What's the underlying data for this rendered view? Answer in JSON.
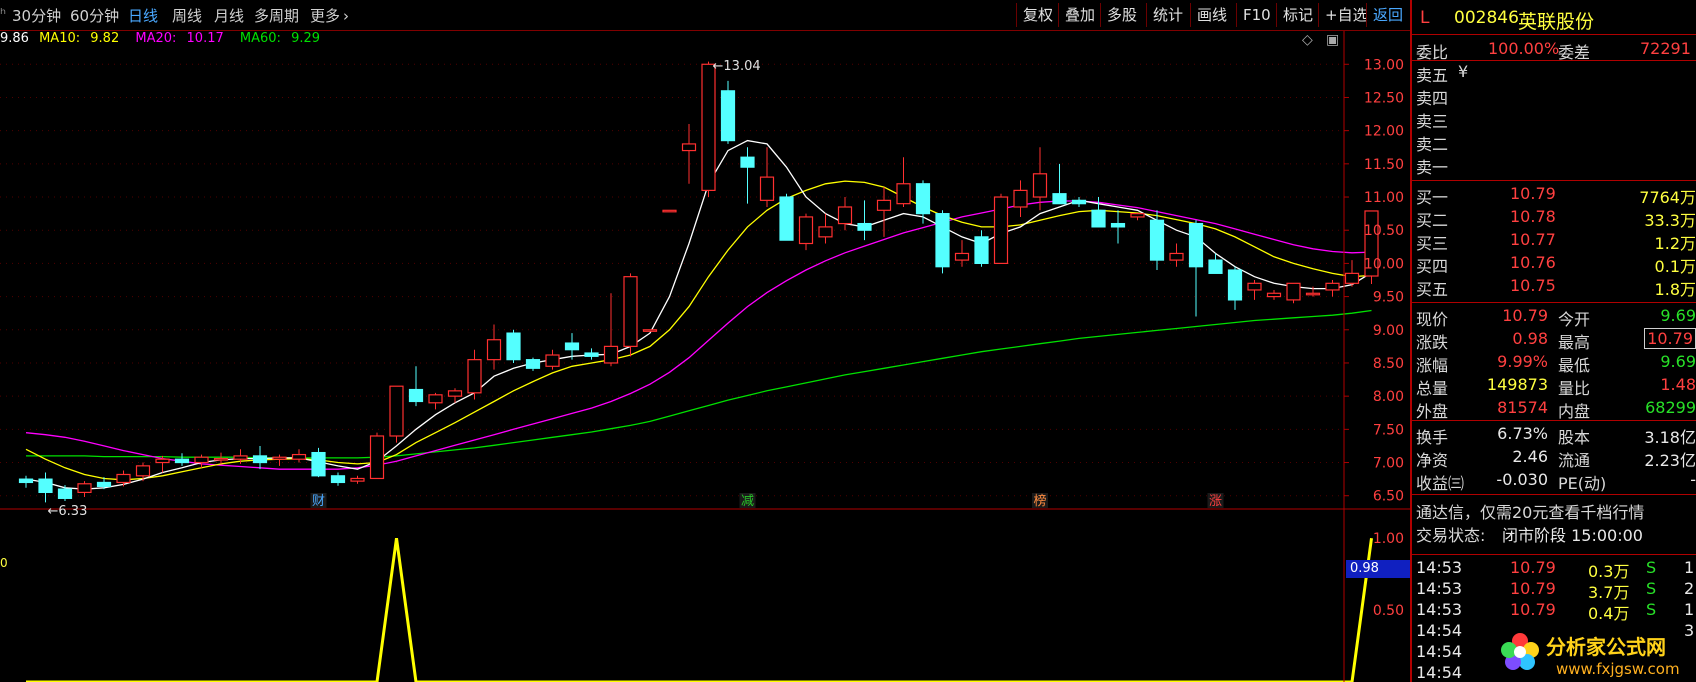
{
  "toolbar": {
    "edge_glyph": "ʰ",
    "periods": [
      "30分钟",
      "60分钟",
      "日线",
      "周线",
      "月线",
      "多周期",
      "更多"
    ],
    "active_period": "日线",
    "more_chevron": "›",
    "buttons": [
      "复权",
      "叠加",
      "多股",
      "统计",
      "画线",
      "F10",
      "标记",
      "+自选",
      "返回"
    ]
  },
  "ma": {
    "ma5": "9.86",
    "ma10_label": "MA10:",
    "ma10": "9.82",
    "ma20_label": "MA20:",
    "ma20": "10.17",
    "ma60_label": "MA60:",
    "ma60": "9.29",
    "colors": {
      "ma5": "#ffffff",
      "ma10": "#ffff00",
      "ma20": "#ff00ff",
      "ma60": "#00e000"
    }
  },
  "chart_icons": {
    "diamond": "◇",
    "window": "▣"
  },
  "annotations": {
    "high": "13.04",
    "low": "6.33",
    "arrow_high": "←",
    "arrow_low": "←"
  },
  "event_markers": [
    {
      "label": "财",
      "color": "#4aa8ff"
    },
    {
      "label": "减",
      "color": "#28c828"
    },
    {
      "label": "榜",
      "color": "#ff8c40"
    },
    {
      "label": "涨",
      "color": "#ff4040"
    }
  ],
  "indicator": {
    "value_badge": "0.98",
    "left_tag": "0",
    "ticks": [
      "1.00",
      "0.50"
    ]
  },
  "chart_data": {
    "type": "candlestick",
    "ylim": [
      6.3,
      13.2
    ],
    "y_ticks": [
      "13.00",
      "12.50",
      "12.00",
      "11.50",
      "11.00",
      "10.50",
      "10.00",
      "9.50",
      "9.00",
      "8.50",
      "8.00",
      "7.50",
      "7.00",
      "6.50"
    ],
    "candles": [
      [
        6.75,
        6.8,
        6.62,
        6.7
      ],
      [
        6.75,
        6.85,
        6.4,
        6.55
      ],
      [
        6.6,
        6.66,
        6.42,
        6.46
      ],
      [
        6.55,
        6.72,
        6.48,
        6.68
      ],
      [
        6.7,
        6.78,
        6.6,
        6.64
      ],
      [
        6.7,
        6.88,
        6.64,
        6.82
      ],
      [
        6.8,
        7.0,
        6.72,
        6.95
      ],
      [
        7.0,
        7.1,
        6.85,
        7.05
      ],
      [
        7.05,
        7.14,
        6.95,
        7.0
      ],
      [
        7.0,
        7.12,
        6.92,
        7.08
      ],
      [
        7.05,
        7.15,
        6.98,
        7.06
      ],
      [
        7.05,
        7.2,
        6.98,
        7.1
      ],
      [
        7.1,
        7.25,
        6.9,
        7.0
      ],
      [
        7.05,
        7.12,
        6.95,
        7.08
      ],
      [
        7.05,
        7.2,
        7.0,
        7.12
      ],
      [
        7.15,
        7.22,
        6.78,
        6.8
      ],
      [
        6.8,
        6.85,
        6.65,
        6.7
      ],
      [
        6.72,
        6.8,
        6.68,
        6.76
      ],
      [
        6.76,
        7.45,
        6.76,
        7.4
      ],
      [
        7.4,
        8.15,
        7.3,
        8.15
      ],
      [
        8.1,
        8.45,
        7.85,
        7.92
      ],
      [
        7.9,
        8.05,
        7.8,
        8.02
      ],
      [
        8.0,
        8.12,
        7.9,
        8.08
      ],
      [
        8.05,
        8.7,
        7.95,
        8.55
      ],
      [
        8.55,
        9.08,
        8.4,
        8.85
      ],
      [
        8.95,
        9.0,
        8.5,
        8.55
      ],
      [
        8.55,
        8.58,
        8.38,
        8.42
      ],
      [
        8.45,
        8.7,
        8.4,
        8.62
      ],
      [
        8.8,
        8.95,
        8.55,
        8.7
      ],
      [
        8.65,
        8.72,
        8.55,
        8.6
      ],
      [
        8.5,
        9.55,
        8.45,
        8.75
      ],
      [
        8.75,
        9.85,
        8.6,
        9.8
      ],
      [
        9.0,
        9.0,
        9.0,
        9.0
      ],
      [
        10.8,
        10.8,
        10.8,
        10.8
      ],
      [
        11.7,
        12.1,
        11.2,
        11.8
      ],
      [
        11.1,
        13.04,
        11.0,
        13.0
      ],
      [
        12.6,
        12.75,
        11.8,
        11.85
      ],
      [
        11.6,
        11.75,
        10.9,
        11.45
      ],
      [
        10.95,
        11.75,
        10.85,
        11.3
      ],
      [
        11.0,
        11.05,
        10.35,
        10.35
      ],
      [
        10.3,
        10.75,
        10.2,
        10.7
      ],
      [
        10.4,
        10.75,
        10.3,
        10.55
      ],
      [
        10.6,
        11.0,
        10.5,
        10.85
      ],
      [
        10.6,
        10.95,
        10.35,
        10.5
      ],
      [
        10.8,
        11.15,
        10.4,
        10.95
      ],
      [
        10.9,
        11.6,
        10.85,
        11.2
      ],
      [
        11.2,
        11.25,
        10.6,
        10.75
      ],
      [
        10.75,
        10.8,
        9.85,
        9.95
      ],
      [
        10.05,
        10.35,
        9.95,
        10.15
      ],
      [
        10.4,
        10.5,
        9.95,
        10.0
      ],
      [
        10.0,
        11.05,
        10.0,
        11.0
      ],
      [
        10.85,
        11.25,
        10.7,
        11.1
      ],
      [
        11.0,
        11.75,
        10.8,
        11.35
      ],
      [
        11.05,
        11.5,
        10.95,
        10.9
      ],
      [
        10.95,
        11.0,
        10.85,
        10.9
      ],
      [
        10.8,
        11.0,
        10.6,
        10.55
      ],
      [
        10.6,
        10.8,
        10.3,
        10.55
      ],
      [
        10.7,
        10.75,
        10.65,
        10.75
      ],
      [
        10.65,
        10.8,
        9.9,
        10.05
      ],
      [
        10.05,
        10.3,
        9.95,
        10.15
      ],
      [
        10.6,
        10.65,
        9.2,
        9.95
      ],
      [
        10.05,
        10.15,
        9.85,
        9.85
      ],
      [
        9.9,
        9.95,
        9.3,
        9.45
      ],
      [
        9.6,
        9.75,
        9.45,
        9.7
      ],
      [
        9.5,
        9.6,
        9.45,
        9.55
      ],
      [
        9.45,
        9.65,
        9.4,
        9.7
      ],
      [
        9.55,
        9.65,
        9.5,
        9.55
      ],
      [
        9.6,
        9.75,
        9.5,
        9.7
      ],
      [
        9.7,
        10.05,
        9.65,
        9.85
      ],
      [
        9.81,
        10.79,
        9.69,
        10.79
      ]
    ],
    "ma5": [
      6.75,
      6.7,
      6.62,
      6.6,
      6.62,
      6.67,
      6.75,
      6.85,
      6.92,
      7.0,
      7.04,
      7.06,
      7.06,
      7.07,
      7.07,
      7.01,
      6.95,
      6.9,
      7.02,
      7.25,
      7.5,
      7.72,
      7.9,
      8.05,
      8.3,
      8.42,
      8.5,
      8.55,
      8.6,
      8.62,
      8.63,
      8.75,
      8.95,
      9.5,
      10.3,
      11.2,
      11.7,
      11.85,
      11.8,
      11.45,
      11.0,
      10.75,
      10.6,
      10.55,
      10.65,
      10.75,
      10.7,
      10.55,
      10.4,
      10.3,
      10.45,
      10.55,
      10.75,
      10.85,
      10.95,
      10.9,
      10.85,
      10.8,
      10.65,
      10.5,
      10.4,
      10.15,
      9.95,
      9.8,
      9.7,
      9.65,
      9.62,
      9.62,
      9.68,
      9.86
    ],
    "ma10": [
      7.2,
      7.05,
      6.92,
      6.82,
      6.76,
      6.74,
      6.76,
      6.8,
      6.86,
      6.92,
      6.98,
      7.02,
      7.04,
      7.05,
      7.06,
      7.04,
      7.0,
      6.98,
      7.0,
      7.12,
      7.3,
      7.45,
      7.6,
      7.76,
      7.92,
      8.08,
      8.22,
      8.35,
      8.45,
      8.5,
      8.55,
      8.62,
      8.75,
      9.0,
      9.35,
      9.8,
      10.2,
      10.55,
      10.8,
      10.98,
      11.1,
      11.2,
      11.24,
      11.22,
      11.15,
      11.0,
      10.85,
      10.72,
      10.62,
      10.55,
      10.55,
      10.58,
      10.65,
      10.72,
      10.78,
      10.8,
      10.78,
      10.76,
      10.72,
      10.66,
      10.6,
      10.52,
      10.4,
      10.25,
      10.1,
      10.0,
      9.92,
      9.85,
      9.8,
      9.82
    ],
    "ma20": [
      7.45,
      7.42,
      7.38,
      7.32,
      7.25,
      7.18,
      7.12,
      7.06,
      7.02,
      6.98,
      6.96,
      6.94,
      6.92,
      6.9,
      6.9,
      6.9,
      6.9,
      6.92,
      6.96,
      7.02,
      7.1,
      7.18,
      7.26,
      7.34,
      7.42,
      7.5,
      7.58,
      7.66,
      7.74,
      7.82,
      7.92,
      8.04,
      8.18,
      8.36,
      8.58,
      8.84,
      9.1,
      9.35,
      9.56,
      9.74,
      9.9,
      10.04,
      10.16,
      10.26,
      10.36,
      10.46,
      10.54,
      10.62,
      10.7,
      10.76,
      10.82,
      10.88,
      10.92,
      10.94,
      10.94,
      10.92,
      10.88,
      10.84,
      10.78,
      10.72,
      10.66,
      10.6,
      10.52,
      10.44,
      10.36,
      10.28,
      10.22,
      10.18,
      10.16,
      10.17
    ],
    "ma60": [
      7.1,
      7.1,
      7.1,
      7.1,
      7.09,
      7.09,
      7.09,
      7.09,
      7.08,
      7.08,
      7.08,
      7.08,
      7.07,
      7.07,
      7.07,
      7.07,
      7.07,
      7.07,
      7.08,
      7.1,
      7.13,
      7.16,
      7.19,
      7.22,
      7.26,
      7.3,
      7.34,
      7.38,
      7.42,
      7.46,
      7.51,
      7.56,
      7.62,
      7.7,
      7.78,
      7.86,
      7.94,
      8.01,
      8.08,
      8.14,
      8.2,
      8.26,
      8.32,
      8.37,
      8.42,
      8.47,
      8.52,
      8.57,
      8.62,
      8.67,
      8.71,
      8.75,
      8.79,
      8.83,
      8.87,
      8.9,
      8.93,
      8.96,
      8.99,
      9.02,
      9.05,
      9.08,
      9.11,
      9.14,
      9.16,
      9.18,
      9.2,
      9.22,
      9.25,
      9.29
    ],
    "indicator": [
      0,
      0,
      0,
      0,
      0,
      0,
      0,
      0,
      0,
      0,
      0,
      0,
      0,
      0,
      0,
      0,
      0,
      0,
      0,
      1.0,
      0,
      0,
      0,
      0,
      0,
      0,
      0,
      0,
      0,
      0,
      0,
      0,
      0,
      0,
      0,
      0,
      0,
      0,
      0,
      0,
      0,
      0,
      0,
      0,
      0,
      0,
      0,
      0,
      0,
      0,
      0,
      0,
      0,
      0,
      0,
      0,
      0,
      0,
      0,
      0,
      0,
      0,
      0,
      0,
      0,
      0,
      0,
      0,
      0,
      1.0
    ],
    "indicator_ylim": [
      0,
      1.05
    ]
  },
  "panel": {
    "prefix": "L",
    "code": "002846",
    "name": "英联股份",
    "weibi_label": "委比",
    "weibi": "100.00%",
    "weicha_label": "委差",
    "weicha": "72291",
    "sell": [
      {
        "label": "卖五",
        "mark": "¥"
      },
      {
        "label": "卖四",
        "mark": ""
      },
      {
        "label": "卖三",
        "mark": ""
      },
      {
        "label": "卖二",
        "mark": ""
      },
      {
        "label": "卖一",
        "mark": ""
      }
    ],
    "buy": [
      {
        "label": "买一",
        "price": "10.79",
        "vol": "7764万"
      },
      {
        "label": "买二",
        "price": "10.78",
        "vol": "33.3万"
      },
      {
        "label": "买三",
        "price": "10.77",
        "vol": "1.2万"
      },
      {
        "label": "买四",
        "price": "10.76",
        "vol": "0.1万"
      },
      {
        "label": "买五",
        "price": "10.75",
        "vol": "1.8万"
      }
    ],
    "quote": [
      {
        "l1": "现价",
        "v1": "10.79",
        "c1": "red",
        "l2": "今开",
        "v2": "9.69",
        "c2": "grn"
      },
      {
        "l1": "涨跌",
        "v1": "0.98",
        "c1": "red",
        "l2": "最高",
        "v2": "10.79",
        "c2": "red",
        "box": true
      },
      {
        "l1": "涨幅",
        "v1": "9.99%",
        "c1": "red",
        "l2": "最低",
        "v2": "9.69",
        "c2": "grn"
      },
      {
        "l1": "总量",
        "v1": "149873",
        "c1": "yel",
        "l2": "量比",
        "v2": "1.48",
        "c2": "red"
      },
      {
        "l1": "外盘",
        "v1": "81574",
        "c1": "red",
        "l2": "内盘",
        "v2": "68299",
        "c2": "grn"
      }
    ],
    "fund": [
      {
        "l1": "换手",
        "v1": "6.73%",
        "l2": "股本",
        "v2": "3.18亿"
      },
      {
        "l1": "净资",
        "v1": "2.46",
        "l2": "流通",
        "v2": "2.23亿"
      },
      {
        "l1": "收益㈢",
        "v1": "-0.030",
        "l2": "PE(动)",
        "v2": "-"
      }
    ],
    "promo": "通达信，仅需20元查看千档行情",
    "status_label": "交易状态:",
    "status_value": "闭市阶段 15:00:00",
    "ticks": [
      {
        "time": "14:53",
        "price": "10.79",
        "vol": "0.3万",
        "flag": "S",
        "extra": "1"
      },
      {
        "time": "14:53",
        "price": "10.79",
        "vol": "3.7万",
        "flag": "S",
        "extra": "2"
      },
      {
        "time": "14:53",
        "price": "10.79",
        "vol": "0.4万",
        "flag": "S",
        "extra": "1"
      },
      {
        "time": "14:54",
        "price": "",
        "vol": "",
        "flag": "",
        "extra": "3"
      },
      {
        "time": "14:54",
        "price": "",
        "vol": "",
        "flag": "",
        "extra": ""
      },
      {
        "time": "14:54",
        "price": "",
        "vol": "",
        "flag": "",
        "extra": ""
      }
    ]
  },
  "watermark": {
    "title": "分析家公式网",
    "url": "www.fxjgsw.com"
  }
}
